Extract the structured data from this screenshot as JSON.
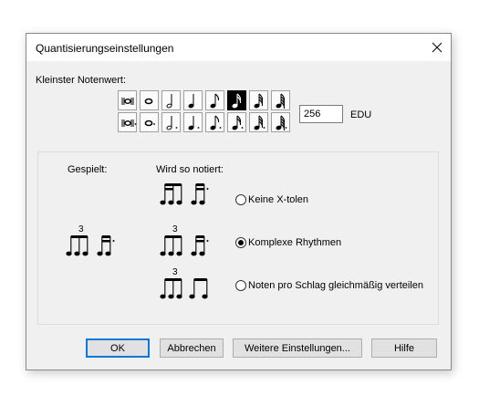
{
  "dialog": {
    "title": "Quantisierungseinstellungen"
  },
  "smallest_note": {
    "label": "Kleinster Notenwert:",
    "row1": [
      "breve",
      "whole",
      "half",
      "quarter",
      "eighth",
      "sixteenth",
      "thirty-second",
      "sixty-fourth"
    ],
    "row2": [
      "dotted-breve",
      "dotted-whole",
      "dotted-half",
      "dotted-quarter",
      "dotted-eighth",
      "dotted-sixteenth",
      "dotted-thirty-second",
      "dotted-sixty-fourth"
    ],
    "selected": "sixteenth",
    "value": "256",
    "unit": "EDU"
  },
  "rhythm_group": {
    "played_label": "Gespielt:",
    "notated_label": "Wird so notiert:",
    "played_tuplet_number": "3",
    "options": [
      {
        "label": "Keine X-tolen",
        "checked": false
      },
      {
        "label": "Komplexe Rhythmen",
        "checked": true,
        "tuplet_number": "3"
      },
      {
        "label": "Noten pro Schlag gleichmäßig verteilen",
        "checked": false,
        "tuplet_number": "3"
      }
    ]
  },
  "buttons": {
    "ok": "OK",
    "cancel": "Abbrechen",
    "more": "Weitere Einstellungen...",
    "help": "Hilfe"
  },
  "colors": {
    "accent": "#0078d7",
    "dialog_bg": "#f0f0f0",
    "selected_bg": "#000000"
  }
}
